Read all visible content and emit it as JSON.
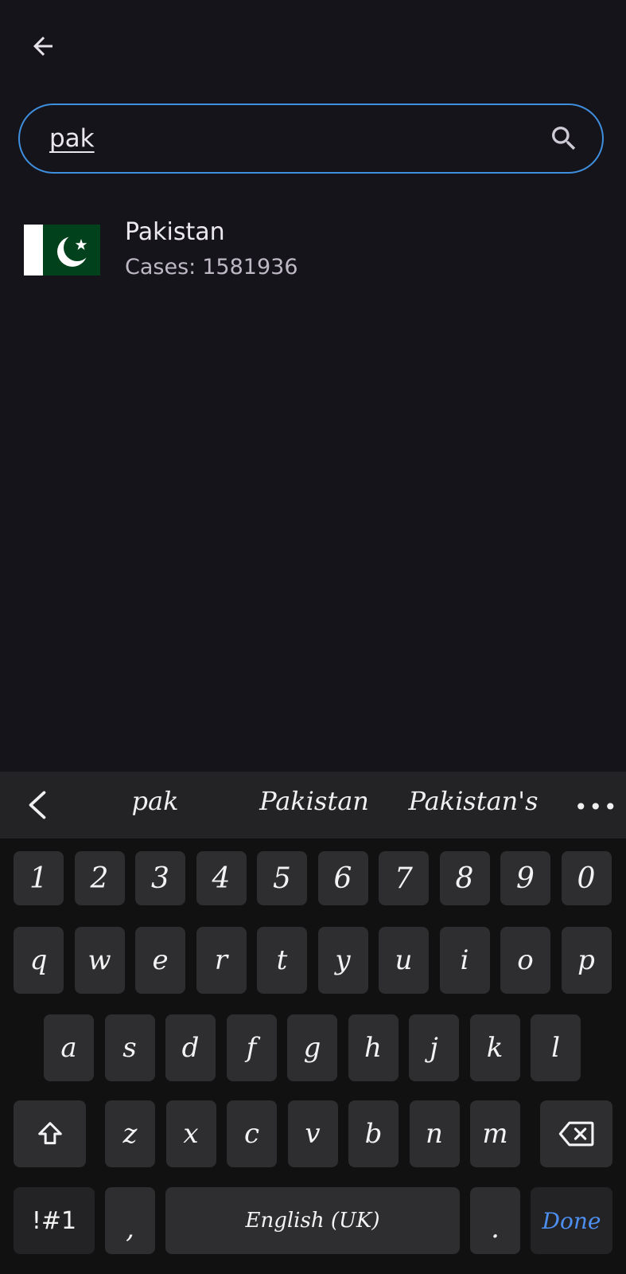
{
  "header": {
    "back_icon": "arrow-left-icon"
  },
  "search": {
    "value": "pak",
    "icon": "search-icon"
  },
  "results": [
    {
      "name": "Pakistan",
      "cases_label": "Cases:",
      "cases_value": "1581936"
    }
  ],
  "keyboard": {
    "suggestions": [
      "pak",
      "Pakistan",
      "Pakistan's"
    ],
    "more_label": "•••",
    "row_numbers": [
      "1",
      "2",
      "3",
      "4",
      "5",
      "6",
      "7",
      "8",
      "9",
      "0"
    ],
    "row_1": [
      "q",
      "w",
      "e",
      "r",
      "t",
      "y",
      "u",
      "i",
      "o",
      "p"
    ],
    "row_2": [
      "a",
      "s",
      "d",
      "f",
      "g",
      "h",
      "j",
      "k",
      "l"
    ],
    "row_3": [
      "z",
      "x",
      "c",
      "v",
      "b",
      "n",
      "m"
    ],
    "symbols_label": "!#1",
    "comma_label": ",",
    "space_label": "English (UK)",
    "period_label": ".",
    "done_label": "Done"
  },
  "colors": {
    "background": "#16141b",
    "search_border": "#3f8fdf",
    "key": "#2e2e30",
    "done": "#4d8ff0",
    "flag_green": "#01411c"
  }
}
